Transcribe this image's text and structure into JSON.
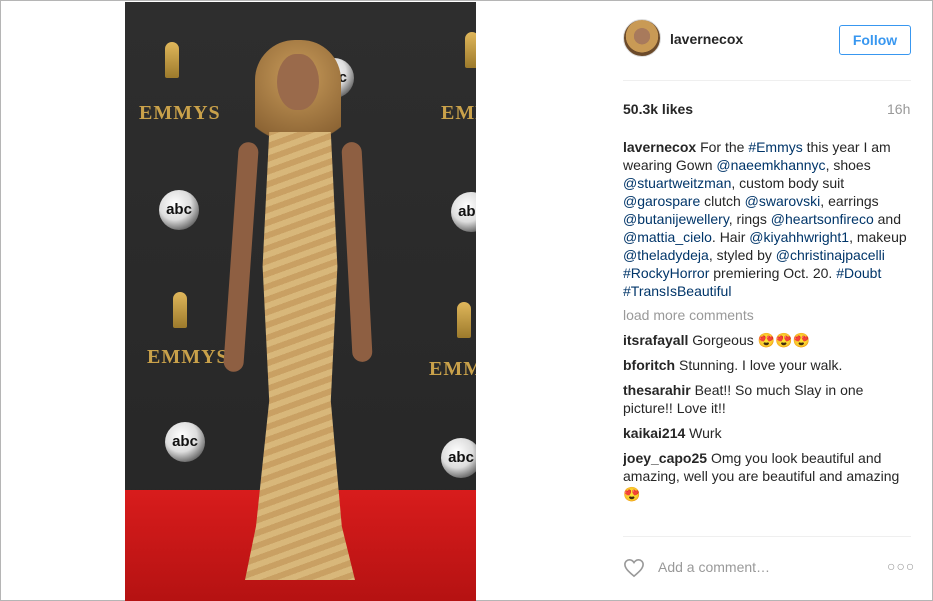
{
  "post": {
    "username": "lavernecox",
    "follow_label": "Follow",
    "likes": "50.3k likes",
    "time": "16h"
  },
  "photo": {
    "logo_text": "EMMYS",
    "abc_text": "abc"
  },
  "caption": {
    "user": "lavernecox",
    "parts": [
      {
        "text": " For the ",
        "tag": false
      },
      {
        "text": "#Emmys",
        "tag": true
      },
      {
        "text": " this year I am wearing Gown ",
        "tag": false
      },
      {
        "text": "@naeemkhannyc",
        "tag": true
      },
      {
        "text": ", shoes ",
        "tag": false
      },
      {
        "text": "@stuartweitzman",
        "tag": true
      },
      {
        "text": ", custom body suit ",
        "tag": false
      },
      {
        "text": "@garospare",
        "tag": true
      },
      {
        "text": " clutch ",
        "tag": false
      },
      {
        "text": "@swarovski",
        "tag": true
      },
      {
        "text": ", earrings ",
        "tag": false
      },
      {
        "text": "@butanijewellery",
        "tag": true
      },
      {
        "text": ", rings ",
        "tag": false
      },
      {
        "text": "@heartsonfireco",
        "tag": true
      },
      {
        "text": " and ",
        "tag": false
      },
      {
        "text": "@mattia_cielo",
        "tag": true
      },
      {
        "text": ". Hair ",
        "tag": false
      },
      {
        "text": "@kiyahhwright1",
        "tag": true
      },
      {
        "text": ", makeup ",
        "tag": false
      },
      {
        "text": "@theladydeja",
        "tag": true
      },
      {
        "text": ", styled by ",
        "tag": false
      },
      {
        "text": "@christinajpacelli",
        "tag": true
      },
      {
        "text": " ",
        "tag": false
      },
      {
        "text": "#RockyHorror",
        "tag": true
      },
      {
        "text": " premiering Oct. 20. ",
        "tag": false
      },
      {
        "text": "#Doubt",
        "tag": true
      },
      {
        "text": " ",
        "tag": false
      },
      {
        "text": "#TransIsBeautiful",
        "tag": true
      }
    ]
  },
  "load_more": "load more comments",
  "comments": [
    {
      "user": "itsrafayall",
      "text": " Gorgeous 😍😍😍"
    },
    {
      "user": "bforitch",
      "text": " Stunning. I love your walk."
    },
    {
      "user": "thesarahir",
      "text": " Beat!! So much Slay in one picture!! Love it!!"
    },
    {
      "user": "kaikai214",
      "text": " Wurk"
    },
    {
      "user": "joey_capo25",
      "text": " Omg you look beautiful and amazing, well you are beautiful and amazing 😍"
    }
  ],
  "footer": {
    "add_comment_placeholder": "Add a comment…",
    "more_label": "○○○"
  },
  "icons": {
    "heart": "heart-icon",
    "more": "more-options-icon"
  }
}
